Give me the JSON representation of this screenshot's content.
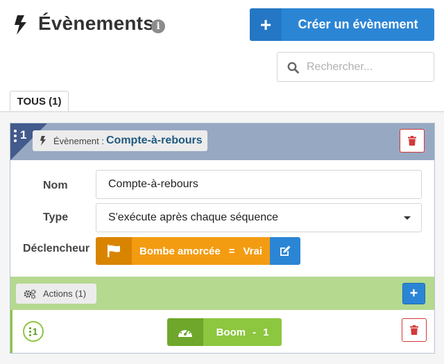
{
  "header": {
    "title": "Évènements",
    "info_icon": "info-icon",
    "create_button_label": "Créer un évènement",
    "create_button_icon": "plus-icon",
    "search_placeholder": "Rechercher..."
  },
  "tabs": [
    {
      "label": "TOUS (1)",
      "active": true
    }
  ],
  "event": {
    "number": "1",
    "pill_label": "Évènement :",
    "pill_name": "Compte-à-rebours",
    "fields": {
      "name_label": "Nom",
      "name_value": "Compte-à-rebours",
      "type_label": "Type",
      "type_value": "S'exécute après chaque séquence",
      "trigger_label": "Déclencheur"
    },
    "trigger": {
      "icon": "flag-icon",
      "subject": "Bombe amorcée",
      "operator": "=",
      "value": "Vrai",
      "edit_icon": "edit-icon"
    },
    "actions": {
      "label": "Actions (1)",
      "items": [
        {
          "number": "1",
          "name": "Boom",
          "separator": "-",
          "value": "1",
          "icon": "gauge-icon"
        }
      ]
    }
  },
  "colors": {
    "primary": "#2b85d5",
    "danger": "#d23a3a",
    "event_header": "#97a8c3",
    "trigger": "#f39c12",
    "actions_bar": "#b4d98f",
    "action_chip": "#8dc63f"
  }
}
